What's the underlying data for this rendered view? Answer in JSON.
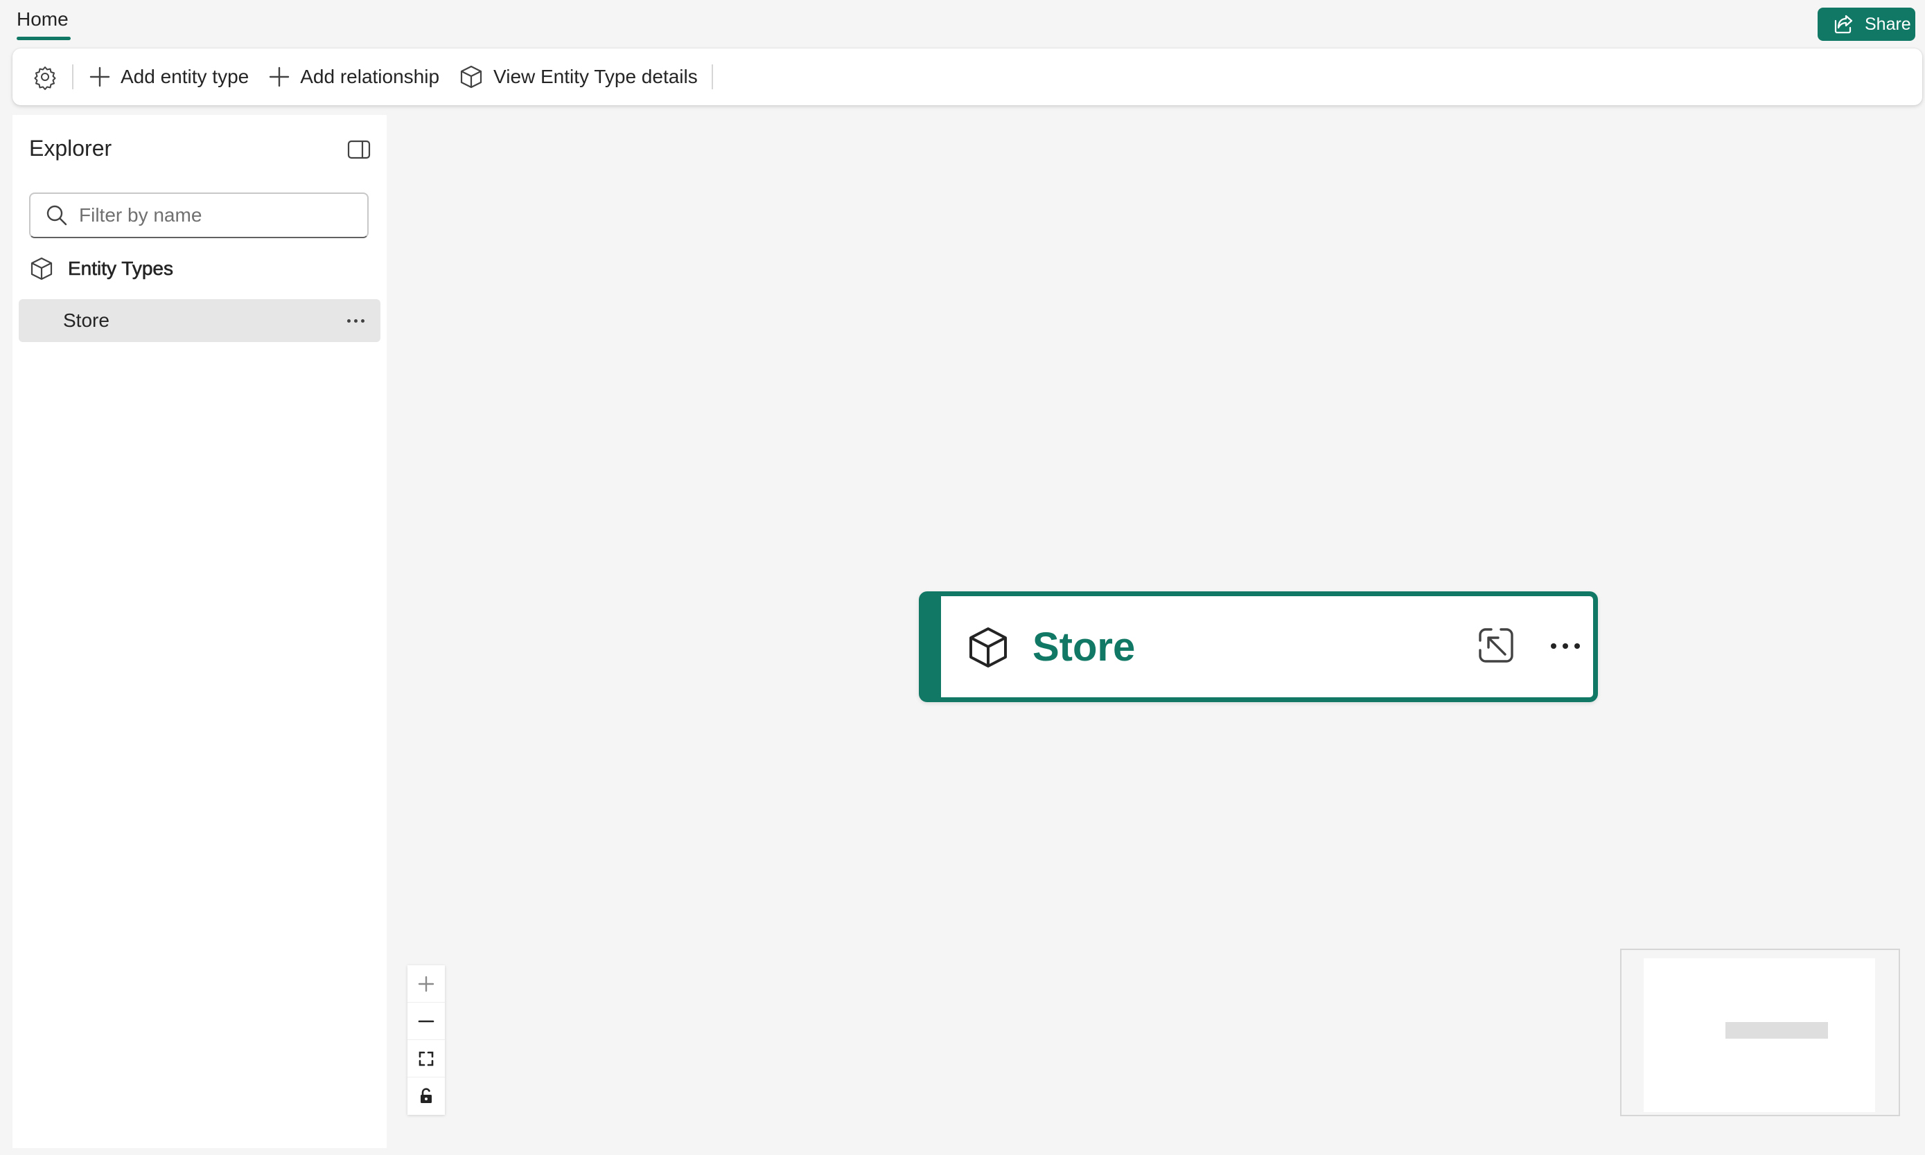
{
  "tabs": {
    "home_label": "Home"
  },
  "header": {
    "share_label": "Share"
  },
  "toolbar": {
    "settings_icon": "gear-icon",
    "add_entity_type_label": "Add entity type",
    "add_relationship_label": "Add relationship",
    "view_details_label": "View Entity Type details"
  },
  "explorer": {
    "title": "Explorer",
    "filter_placeholder": "Filter by name",
    "section_label": "Entity Types",
    "items": [
      {
        "label": "Store"
      }
    ]
  },
  "canvas": {
    "nodes": [
      {
        "title": "Store"
      }
    ],
    "accent_color": "#117865"
  }
}
